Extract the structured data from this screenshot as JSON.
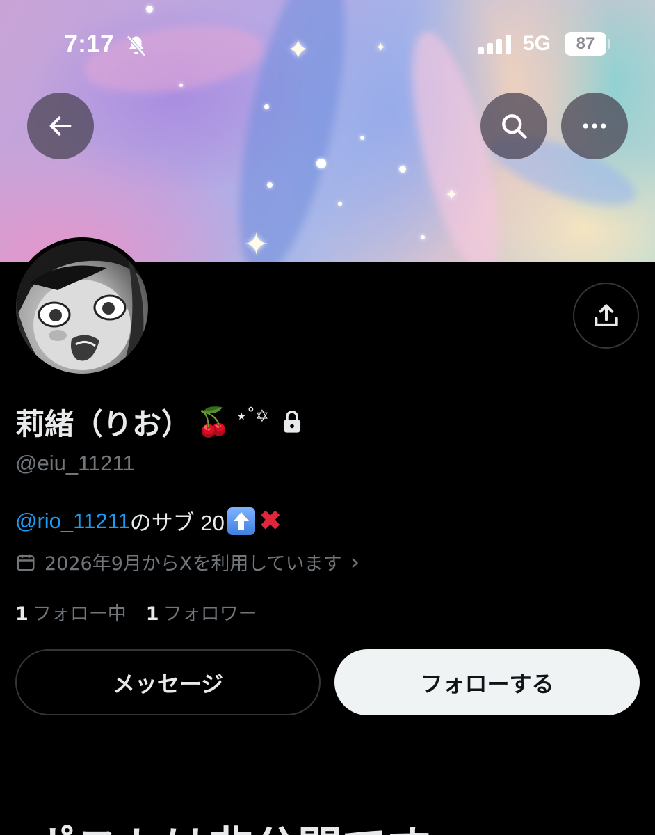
{
  "status_bar": {
    "time": "7:17",
    "network": "5G",
    "battery": "87"
  },
  "header": {
    "back_icon": "arrow-left-icon",
    "search_icon": "search-icon",
    "more_icon": "more-horizontal-icon"
  },
  "profile": {
    "display_name": "莉緒（りお）",
    "name_emoji": "🍒",
    "name_decoration": "⋆˚✡",
    "protected_icon": "lock-icon",
    "handle": "@eiu_11211",
    "bio": {
      "mention": "@rio_11211",
      "text": "のサブ 20",
      "emoji_x": "✖"
    },
    "joined": "2026年9月からXを利用しています",
    "joined_chevron": "›",
    "following_count": "1",
    "following_label": "フォロー中",
    "followers_count": "1",
    "followers_label": "フォロワー"
  },
  "actions": {
    "message_label": "メッセージ",
    "follow_label": "フォローする"
  },
  "private_notice": {
    "heading": "ポストは非公開です"
  },
  "colors": {
    "background": "#000000",
    "text_primary": "#e7e9ea",
    "text_secondary": "#71767b",
    "link": "#1d9bf0",
    "border": "#333639",
    "follow_button_bg": "#eff3f4"
  }
}
